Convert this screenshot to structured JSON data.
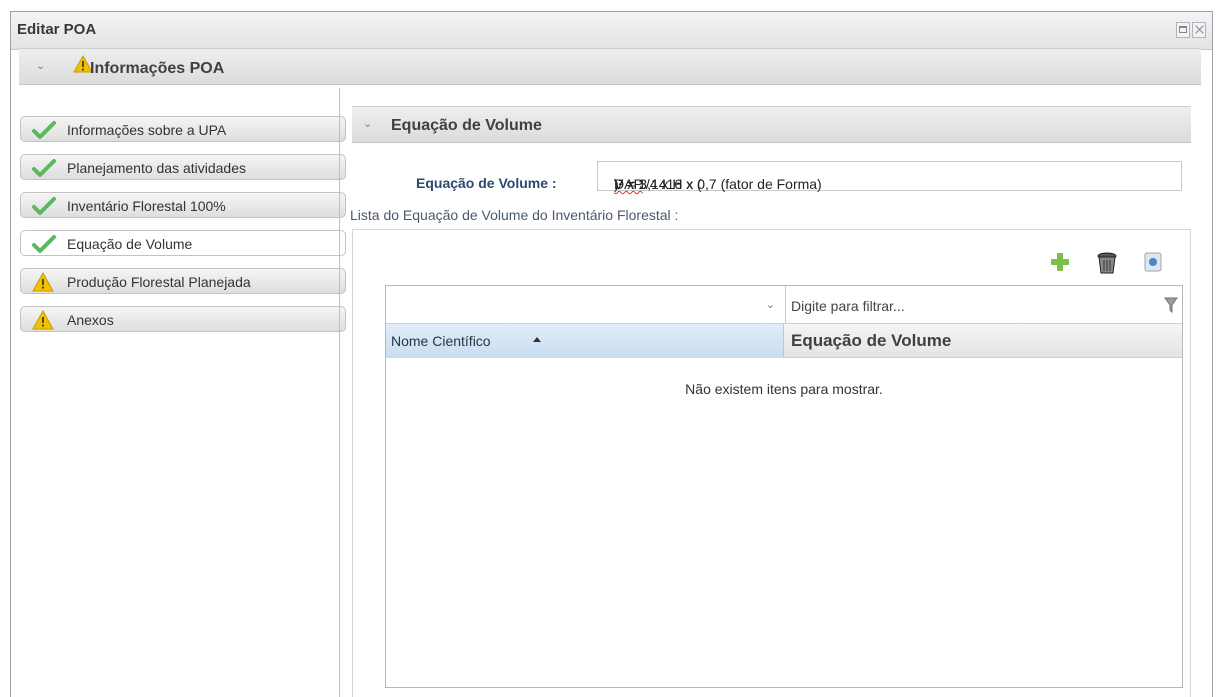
{
  "window": {
    "title": "Editar POA"
  },
  "section": {
    "title": "Informações POA"
  },
  "nav": {
    "items": [
      {
        "label": "Informações sobre a UPA",
        "status": "ok"
      },
      {
        "label": "Planejamento das atividades",
        "status": "ok"
      },
      {
        "label": "Inventário Florestal 100%",
        "status": "ok"
      },
      {
        "label": "Equação de Volume",
        "status": "ok"
      },
      {
        "label": "Produção Florestal Planejada",
        "status": "warning"
      },
      {
        "label": "Anexos",
        "status": "warning"
      }
    ]
  },
  "panel": {
    "title": "Equação de Volume",
    "equation_label": "Equação de Volume :",
    "equation_value_pre": "V = 3,1416 x (",
    "equation_value_mid": "DAP",
    "equation_value_post": ")² x 1/4 x H x 0,7 (fator de Forma)",
    "list_caption": "Lista do Equação de Volume do Inventário Florestal :"
  },
  "grid": {
    "filter_placeholder": "Digite para filtrar...",
    "columns": [
      "Nome Científico",
      "Equação de Volume"
    ],
    "empty_text": "Não existem itens para mostrar."
  },
  "icons": {
    "add": "plus-icon",
    "delete": "trash-icon",
    "view": "view-icon",
    "ok": "check-icon",
    "warning": "warning-icon"
  },
  "colors": {
    "ok": "#5cb85c",
    "warning": "#f2c200",
    "accent": "#2c4a6e"
  }
}
